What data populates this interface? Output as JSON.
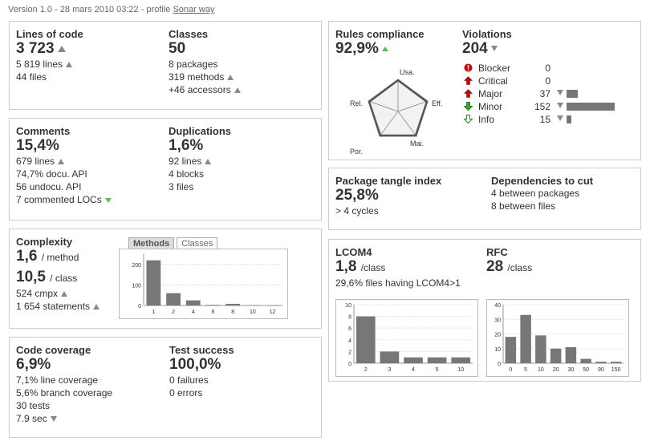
{
  "header": {
    "version_text": "Version 1.0 - 28 mars 2010 03:22 - profile",
    "profile_link": "Sonar way"
  },
  "lines_of_code": {
    "label": "Lines of code",
    "value": "3 723",
    "lines": "5 819 lines",
    "files": "44 files"
  },
  "classes": {
    "label": "Classes",
    "value": "50",
    "packages": "8 packages",
    "methods": "319 methods",
    "accessors": "+46 accessors"
  },
  "comments": {
    "label": "Comments",
    "value": "15,4%",
    "lines": "679 lines",
    "docu_api": "74,7% docu. API",
    "undocu_api": "56 undocu. API",
    "commented_locs": "7 commented LOCs"
  },
  "duplications": {
    "label": "Duplications",
    "value": "1,6%",
    "lines": "92 lines",
    "blocks": "4 blocks",
    "files": "3 files"
  },
  "complexity": {
    "label": "Complexity",
    "per_method_value": "1,6",
    "per_method_unit": "/ method",
    "per_class_value": "10,5",
    "per_class_unit": "/ class",
    "cmpx": "524 cmpx",
    "statements": "1 654 statements",
    "tabs": [
      {
        "label": "Methods"
      },
      {
        "label": "Classes"
      }
    ]
  },
  "coverage": {
    "label": "Code coverage",
    "value": "6,9%",
    "line_cov": "7,1% line coverage",
    "branch_cov": "5,6% branch coverage",
    "tests": "30 tests",
    "time": "7.9 sec"
  },
  "test_success": {
    "label": "Test success",
    "value": "100,0%",
    "failures": "0 failures",
    "errors": "0 errors"
  },
  "rules": {
    "label": "Rules compliance",
    "value": "92,9%",
    "radar_labels": {
      "usa": "Usa.",
      "eff": "Eff.",
      "mai": "Mai.",
      "por": "Por.",
      "rel": "Rel."
    }
  },
  "violations": {
    "label": "Violations",
    "value": "204",
    "rows": [
      {
        "name": "Blocker",
        "count": "0",
        "icon": "blocker-icon",
        "color": "#cc0000"
      },
      {
        "name": "Critical",
        "count": "0",
        "icon": "critical-arrow-icon",
        "color": "#cc0000"
      },
      {
        "name": "Major",
        "count": "37",
        "icon": "major-arrow-icon",
        "color": "#cc0000",
        "bar": 0.24
      },
      {
        "name": "Minor",
        "count": "152",
        "icon": "minor-arrow-icon",
        "color": "#33aa33",
        "bar": 1.0
      },
      {
        "name": "Info",
        "count": "15",
        "icon": "info-arrow-icon",
        "color": "#33aa33",
        "bar": 0.1
      }
    ]
  },
  "tangle": {
    "label": "Package tangle index",
    "value": "25,8%",
    "cycles": "> 4 cycles"
  },
  "deps": {
    "label": "Dependencies to cut",
    "packages": "4 between packages",
    "files": "8 between files"
  },
  "lcom4": {
    "label": "LCOM4",
    "value": "1,8",
    "unit": "/class",
    "files_having": "29,6% files having LCOM4>1"
  },
  "rfc": {
    "label": "RFC",
    "value": "28",
    "unit": "/class"
  },
  "chart_data": [
    {
      "type": "bar",
      "name": "complexity-methods",
      "categories": [
        "1",
        "2",
        "4",
        "6",
        "8",
        "10",
        "12"
      ],
      "values": [
        220,
        60,
        25,
        3,
        8,
        2,
        1
      ],
      "ylim": [
        0,
        250
      ],
      "yticks": [
        0,
        100,
        200
      ]
    },
    {
      "type": "bar",
      "name": "lcom4",
      "categories": [
        "2",
        "3",
        "4",
        "5",
        "10"
      ],
      "values": [
        8,
        2,
        1,
        1,
        1
      ],
      "ylim": [
        0,
        10
      ],
      "yticks": [
        0,
        2,
        4,
        6,
        8,
        10
      ]
    },
    {
      "type": "bar",
      "name": "rfc",
      "categories": [
        "0",
        "5",
        "10",
        "20",
        "30",
        "50",
        "90",
        "150"
      ],
      "values": [
        18,
        33,
        19,
        10,
        11,
        3,
        1,
        1
      ],
      "ylim": [
        0,
        40
      ],
      "yticks": [
        0,
        10,
        20,
        30,
        40
      ]
    }
  ]
}
